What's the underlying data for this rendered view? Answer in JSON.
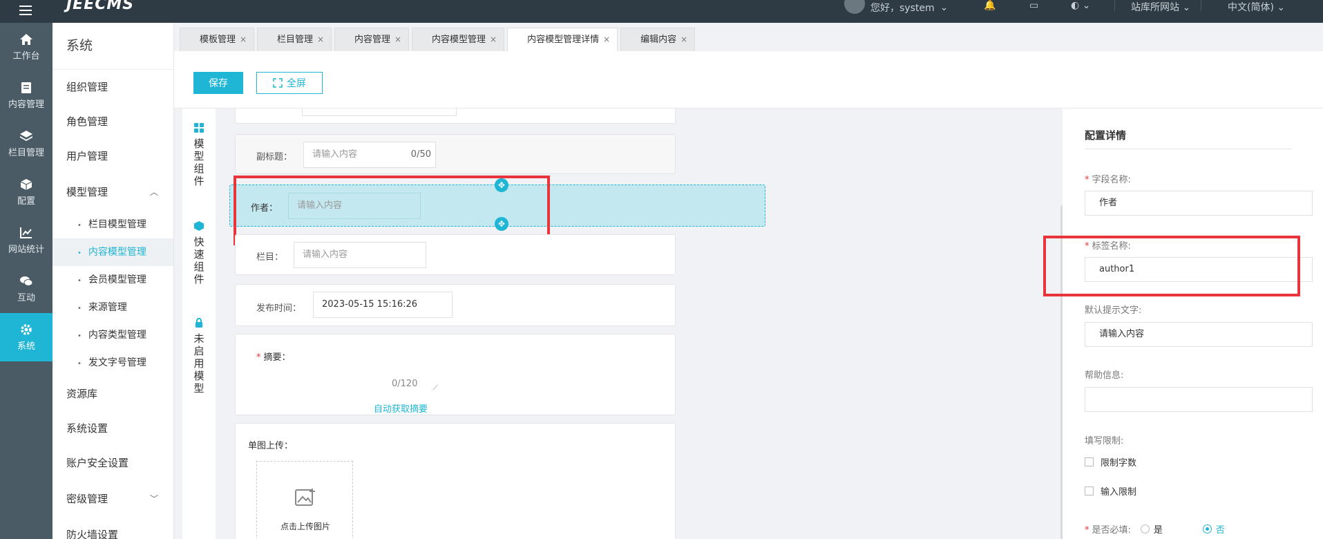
{
  "topbar": {
    "logo": "JEECMS",
    "greeting": "您好，system",
    "site": "站库所网站",
    "language": "中文(简体)"
  },
  "nav": {
    "items": [
      {
        "label": "工作台",
        "icon": "home-icon"
      },
      {
        "label": "内容管理",
        "icon": "document-icon"
      },
      {
        "label": "栏目管理",
        "icon": "layers-icon"
      },
      {
        "label": "配置",
        "icon": "cube-icon"
      },
      {
        "label": "网站统计",
        "icon": "chart-icon"
      },
      {
        "label": "互动",
        "icon": "chat-icon"
      },
      {
        "label": "系统",
        "icon": "gear-icon"
      }
    ]
  },
  "submenu": {
    "title": "系统",
    "org": "组织管理",
    "role": "角色管理",
    "user": "用户管理",
    "model": "模型管理",
    "model_children": [
      "栏目模型管理",
      "内容模型管理",
      "会员模型管理",
      "来源管理",
      "内容类型管理",
      "发文字号管理"
    ],
    "resource": "资源库",
    "settings": "系统设置",
    "account_security": "账户安全设置",
    "secret": "密级管理",
    "firewall": "防火墙设置"
  },
  "tabs": [
    "模板管理",
    "栏目管理",
    "内容管理",
    "内容模型管理",
    "内容模型管理详情",
    "编辑内容"
  ],
  "toolbar": {
    "save": "保存",
    "fullscreen": "全屏"
  },
  "components": {
    "model": "模型组件",
    "quick": "快速组件",
    "disabled": "未启用模型"
  },
  "form": {
    "subtitle_label": "副标题：",
    "subtitle_placeholder": "请输入内容",
    "subtitle_count": "0/50",
    "author_label": "作者：",
    "author_placeholder": "请输入内容",
    "column_label": "栏目：",
    "column_placeholder": "请输入内容",
    "publish_label": "发布时间：",
    "publish_value": "2023-05-15 15:16:26",
    "summary_label": "摘要：",
    "summary_count": "0/120",
    "auto_summary": "自动获取摘要",
    "upload_label": "单图上传：",
    "upload_hint": "点击上传图片"
  },
  "panel": {
    "title": "配置详情",
    "field_name_label": "字段名称:",
    "field_name_value": "作者",
    "tag_name_label": "标签名称:",
    "tag_name_value": "author1",
    "default_hint_label": "默认提示文字:",
    "default_hint_value": "请输入内容",
    "help_label": "帮助信息:",
    "help_value": "",
    "limit_label": "填写限制:",
    "limit_chars": "限制字数",
    "limit_input": "输入限制",
    "required_label": "是否必填:",
    "yes": "是",
    "no": "否"
  },
  "colors": {
    "accent": "#1fb5d4",
    "highlight": "#e8343b",
    "nav_bg": "#4a5b66",
    "topbar_bg": "#2f3b44"
  }
}
